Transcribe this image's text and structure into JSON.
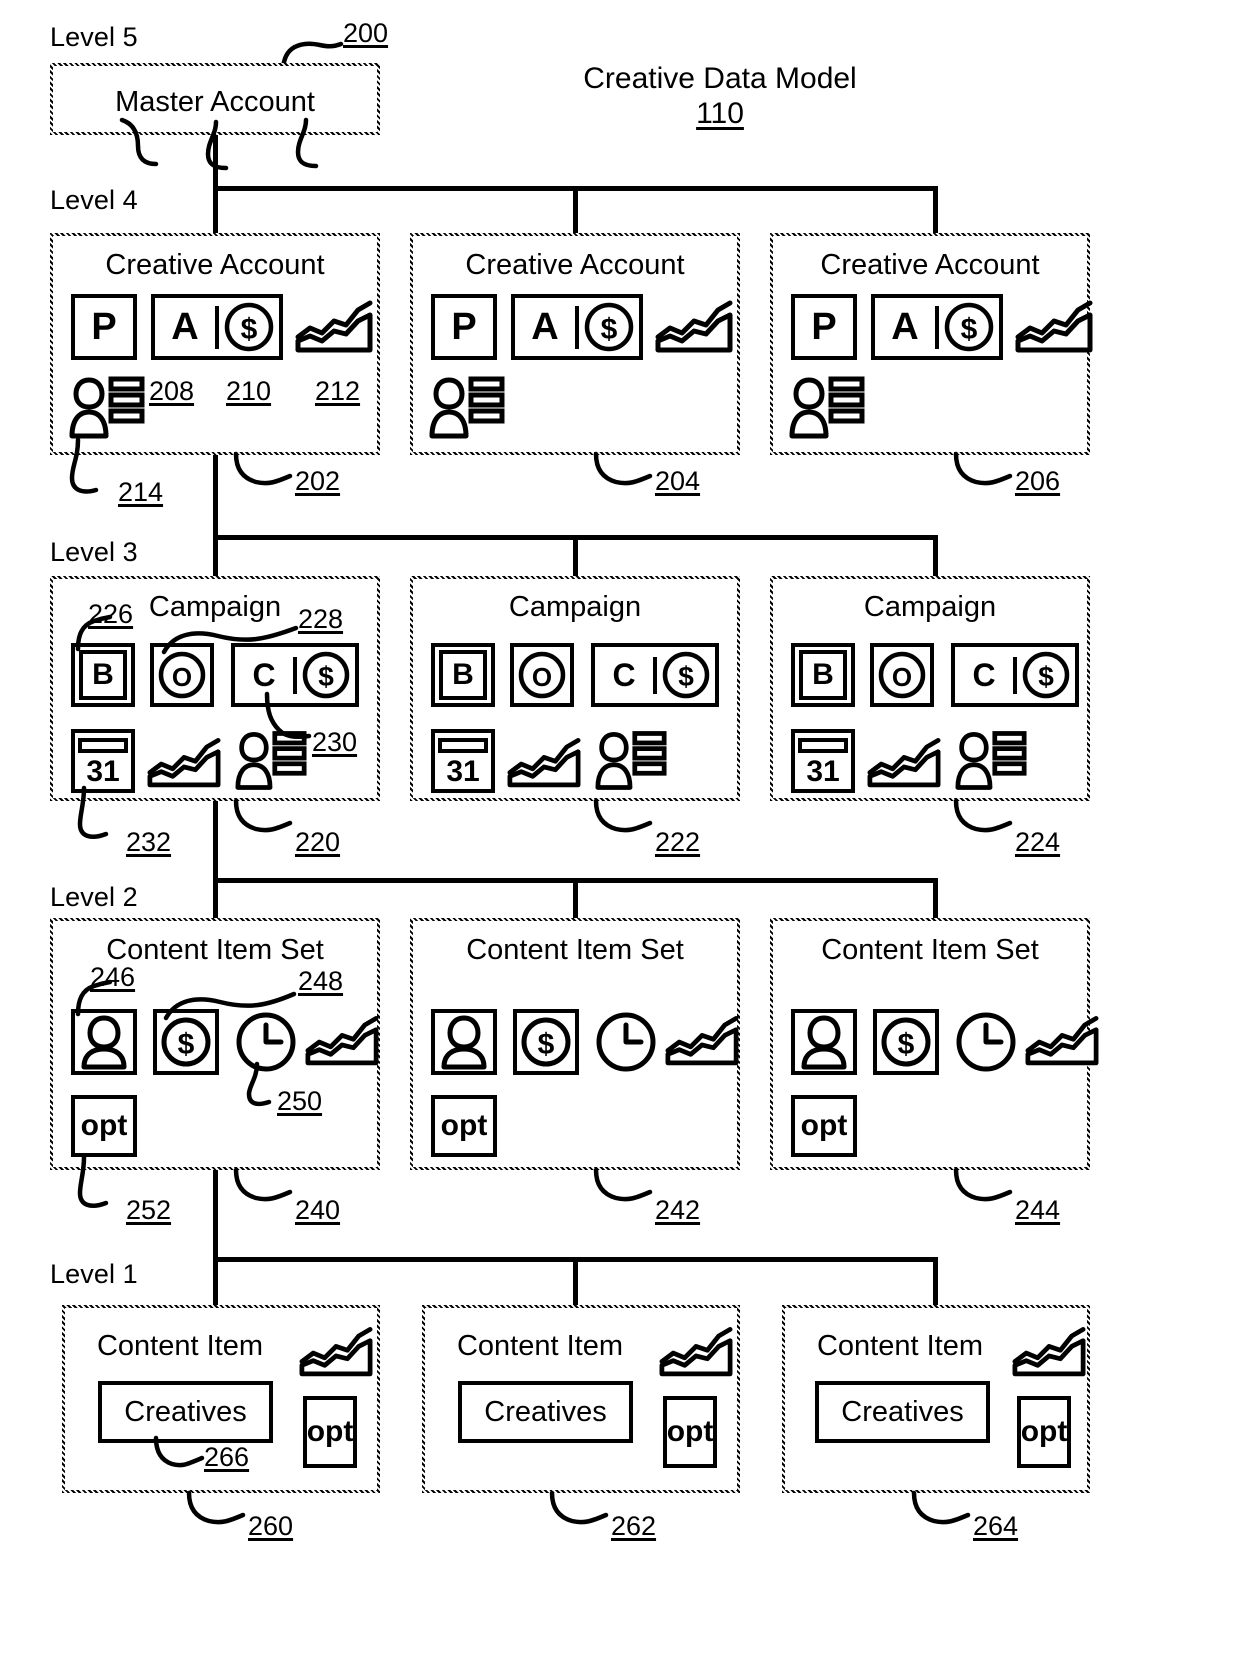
{
  "figure": {
    "model_title": "Creative Data Model",
    "model_ref": "110"
  },
  "levels": [
    {
      "label": "Level 5"
    },
    {
      "label": "Level 4"
    },
    {
      "label": "Level 3"
    },
    {
      "label": "Level 2"
    },
    {
      "label": "Level 1"
    }
  ],
  "level5": {
    "label": "Level 5",
    "node": {
      "title": "Master Account",
      "ref": "200"
    }
  },
  "level4": {
    "label": "Level 4",
    "nodes": [
      {
        "title": "Creative Account",
        "ref": "202"
      },
      {
        "title": "Creative Account",
        "ref": "204"
      },
      {
        "title": "Creative Account",
        "ref": "206"
      }
    ],
    "icons": {
      "p": "P",
      "a": "A",
      "money": "$",
      "chart": "chart-icon",
      "person_list": "person-list-icon"
    },
    "callouts": [
      {
        "ref": "208",
        "target": "p-tile"
      },
      {
        "ref": "210",
        "target": "a-money-tile"
      },
      {
        "ref": "212",
        "target": "chart-icon"
      },
      {
        "ref": "214",
        "target": "person-list-icon"
      }
    ]
  },
  "level3": {
    "label": "Level 3",
    "nodes": [
      {
        "title": "Campaign",
        "ref": "220"
      },
      {
        "title": "Campaign",
        "ref": "222"
      },
      {
        "title": "Campaign",
        "ref": "224"
      }
    ],
    "icons": {
      "b": "B",
      "o": "O",
      "c": "C",
      "money": "$",
      "calendar": "31",
      "chart": "chart-icon",
      "person_list": "person-list-icon"
    },
    "callouts": [
      {
        "ref": "226",
        "target": "b-tile"
      },
      {
        "ref": "228",
        "target": "o-tile"
      },
      {
        "ref": "230",
        "target": "c-money-tile"
      },
      {
        "ref": "232",
        "target": "calendar-icon"
      }
    ]
  },
  "level2": {
    "label": "Level 2",
    "nodes": [
      {
        "title": "Content Item Set",
        "ref": "240"
      },
      {
        "title": "Content Item Set",
        "ref": "242"
      },
      {
        "title": "Content Item Set",
        "ref": "244"
      }
    ],
    "icons": {
      "person": "person-icon",
      "money": "$",
      "clock": "clock-icon",
      "chart": "chart-icon",
      "opt": "opt"
    },
    "callouts": [
      {
        "ref": "246",
        "target": "person-tile"
      },
      {
        "ref": "248",
        "target": "money-tile"
      },
      {
        "ref": "250",
        "target": "clock-icon"
      },
      {
        "ref": "252",
        "target": "opt-box"
      }
    ]
  },
  "level1": {
    "label": "Level 1",
    "nodes": [
      {
        "title": "Content Item",
        "ref": "260"
      },
      {
        "title": "Content Item",
        "ref": "262"
      },
      {
        "title": "Content Item",
        "ref": "264"
      }
    ],
    "icons": {
      "creatives": "Creatives",
      "opt": "opt",
      "chart": "chart-icon"
    },
    "callouts": [
      {
        "ref": "266",
        "target": "creatives-box"
      }
    ]
  },
  "colors": {
    "stroke": "#000000",
    "background": "#ffffff"
  }
}
